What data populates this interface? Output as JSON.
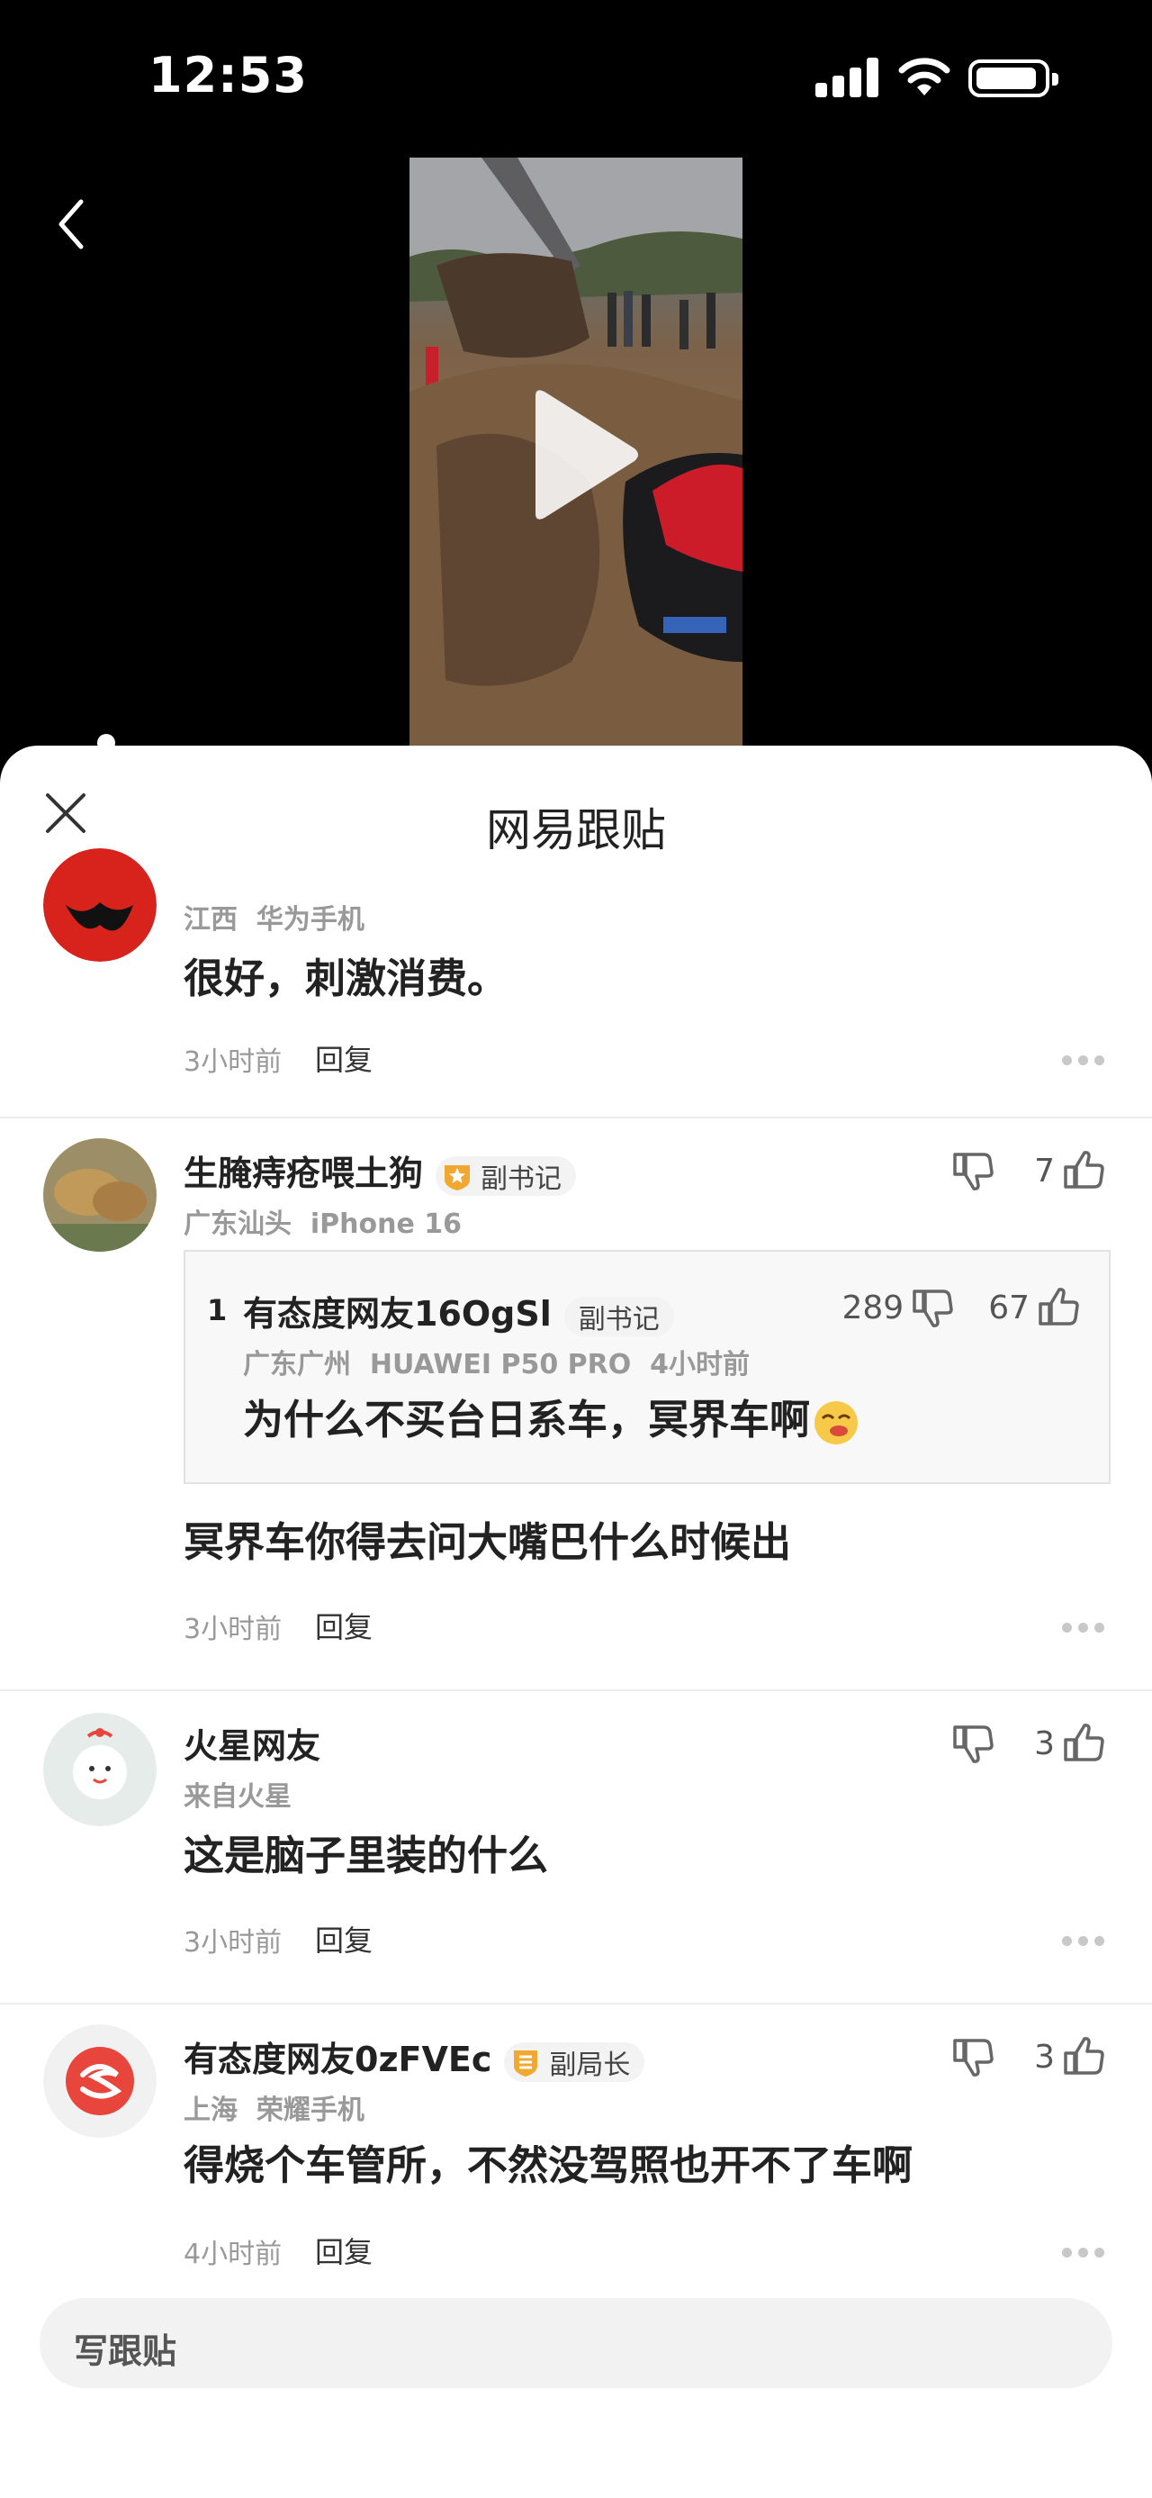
{
  "status_bar": {
    "time": "12:53"
  },
  "sheet": {
    "title": "网易跟贴"
  },
  "comments": [
    {
      "location": "江西",
      "device": "华为手机",
      "text": "很好，刺激消费。",
      "time": "3小时前",
      "reply_label": "回复"
    },
    {
      "username": "生腌痔疮喂土狗",
      "badge": "副书记",
      "location": "广东汕头",
      "device": "iPhone 16",
      "likes": "7",
      "quote": {
        "index": "1",
        "username": "有态度网友16OgSl",
        "badge": "副书记",
        "dislikes": "289",
        "likes": "67",
        "location": "广东广州",
        "device": "HUAWEI P50 PRO",
        "time": "4小时前",
        "text": "为什么不买台日系车，冥界车啊"
      },
      "text": "冥界车你得去问大嘴巴什么时候出",
      "time": "3小时前",
      "reply_label": "回复"
    },
    {
      "username": "火星网友",
      "location": "来自火星",
      "likes": "3",
      "text": "这是脑子里装的什么",
      "time": "3小时前",
      "reply_label": "回复"
    },
    {
      "username": "有态度网友0zFVEc",
      "badge": "副局长",
      "location": "上海",
      "device": "荣耀手机",
      "likes": "3",
      "text": "得烧个车管所，不然没驾照也开不了车啊",
      "time": "4小时前",
      "reply_label": "回复"
    }
  ],
  "composer": {
    "placeholder": "写跟贴"
  },
  "colors": {
    "badge_gold": "#f0a830",
    "accent_red": "#e8463c",
    "meta_gray": "#999999"
  }
}
